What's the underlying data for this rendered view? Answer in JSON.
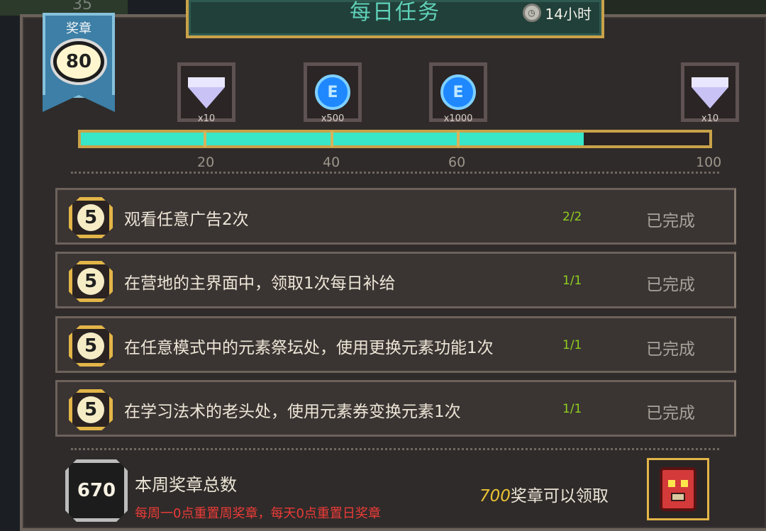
{
  "background": {
    "corner_number": "35"
  },
  "header": {
    "title": "每日任务",
    "timer_text": "14小时",
    "timer_icon": "clock-icon"
  },
  "medal_ribbon": {
    "label": "奖章",
    "value": "80"
  },
  "progress": {
    "value": 80,
    "max": 100,
    "milestones": [
      "20",
      "40",
      "60",
      "100"
    ],
    "rewards": [
      {
        "icon": "gem-icon",
        "qty": "x10"
      },
      {
        "icon": "energy-coin-icon",
        "qty": "x500"
      },
      {
        "icon": "energy-coin-icon",
        "qty": "x1000"
      },
      {
        "icon": "gem-icon",
        "qty": "x10"
      }
    ]
  },
  "tasks": [
    {
      "points": "5",
      "desc": "观看任意广告2次",
      "count": "2/2",
      "status": "已完成"
    },
    {
      "points": "5",
      "desc": "在营地的主界面中，领取1次每日补给",
      "count": "1/1",
      "status": "已完成"
    },
    {
      "points": "5",
      "desc": "在任意模式中的元素祭坛处，使用更换元素功能1次",
      "count": "1/1",
      "status": "已完成"
    },
    {
      "points": "5",
      "desc": "在学习法术的老头处，使用元素券变换元素1次",
      "count": "1/1",
      "status": "已完成"
    }
  ],
  "weekly": {
    "total": "670",
    "label": "本周奖章总数",
    "note": "每周一0点重置周奖章，每天0点重置日奖章",
    "claim_num": "700",
    "claim_text": "奖章可以领取",
    "chest_icon": "red-monster-chest-icon"
  },
  "colors": {
    "accent_teal": "#37e7c8",
    "gold_border": "#c9a24a",
    "count_green": "#8ed11e",
    "note_red": "#ea3b37"
  }
}
